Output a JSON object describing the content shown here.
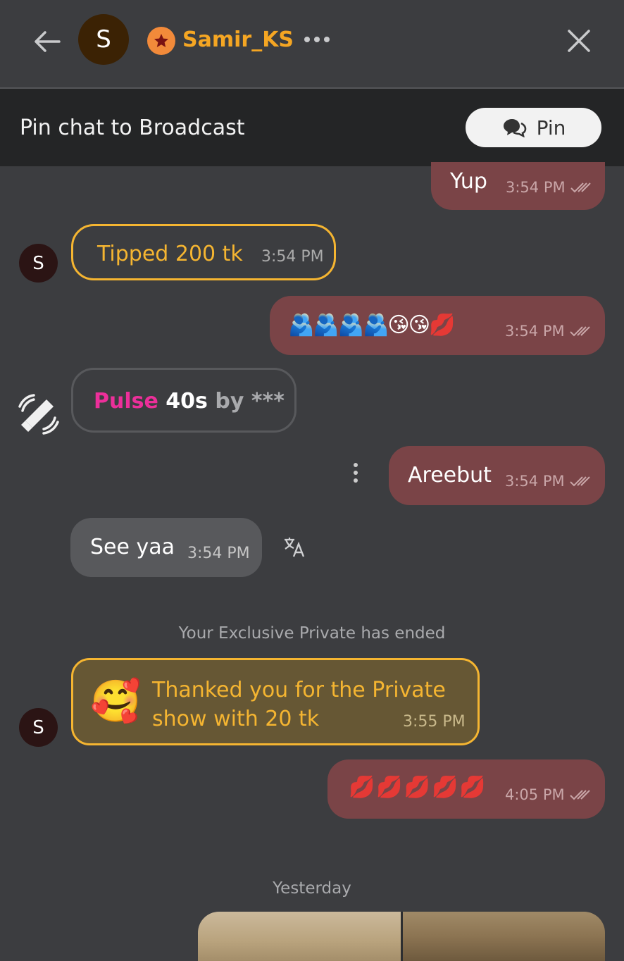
{
  "header": {
    "avatar_letter": "S",
    "username": "Samir_KS",
    "icons": [
      "back-arrow-icon",
      "star-badge-icon",
      "more-dots-icon",
      "close-icon"
    ]
  },
  "pinbar": {
    "text": "Pin chat to Broadcast",
    "button_label": "Pin",
    "button_icon": "chat-bubbles-icon"
  },
  "messages": {
    "m1": {
      "text": "Yup",
      "time": "3:54 PM"
    },
    "tip": {
      "avatar": "S",
      "text": "Tipped 200 tk",
      "time": "3:54 PM"
    },
    "m2": {
      "text": "🫂🫂🫂🫂😘😘💋",
      "time": "3:54 PM"
    },
    "pulse": {
      "word": "Pulse",
      "duration": "40s",
      "by": "by",
      "user": "***"
    },
    "m3": {
      "text": "Areebut",
      "time": "3:54 PM"
    },
    "in1": {
      "text": "See yaa",
      "time": "3:54 PM"
    },
    "system": "Your Exclusive Private has ended",
    "thanks": {
      "avatar": "S",
      "emoji": "🥰",
      "text": "Thanked you for the Private show with 20 tk",
      "time": "3:55 PM"
    },
    "m4": {
      "text": "💋💋💋💋💋",
      "time": "4:05 PM"
    },
    "date_divider": "Yesterday"
  },
  "colors": {
    "background": "#3c3d40",
    "accent": "#f5b531",
    "username": "#f5a623",
    "outgoing_bubble": "#7a4447",
    "incoming_bubble": "#58595c",
    "pulse": "#ec2f9a"
  }
}
